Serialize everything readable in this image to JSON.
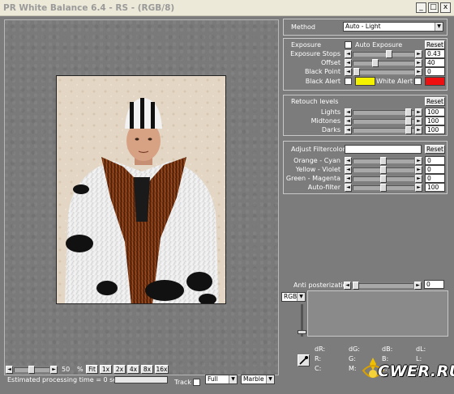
{
  "window": {
    "title": "PR White Balance 6.4 - RS - (RGB/8)",
    "min_glyph": "_",
    "max_glyph": "□",
    "close_glyph": "x"
  },
  "method": {
    "label": "Method",
    "value": "Auto - Light"
  },
  "exposure": {
    "title": "Exposure",
    "auto_label": "Auto Exposure",
    "reset": "Reset",
    "stops": {
      "label": "Exposure Stops",
      "value": "0.43",
      "level": 0.6
    },
    "offset": {
      "label": "Offset",
      "value": "40",
      "level": 0.35
    },
    "black_point": {
      "label": "Black Point",
      "value": "0",
      "level": 0.02
    },
    "black_alert": {
      "label": "Black Alert",
      "color": "#f5f200"
    },
    "white_alert": {
      "label": "White Alert",
      "color": "#ee1010"
    }
  },
  "retouch": {
    "title": "Retouch levels",
    "reset": "Reset",
    "lights": {
      "label": "Lights",
      "value": "100",
      "level": 0.95
    },
    "midtones": {
      "label": "Midtones",
      "value": "100",
      "level": 0.95
    },
    "darks": {
      "label": "Darks",
      "value": "100",
      "level": 0.95
    }
  },
  "filter": {
    "title": "Adjust Filtercolor",
    "reset": "Reset",
    "orange_cyan": {
      "label": "Orange - Cyan",
      "value": "0",
      "level": 0.5
    },
    "yellow_violet": {
      "label": "Yellow - Violet",
      "value": "0",
      "level": 0.5
    },
    "green_magenta": {
      "label": "Green - Magenta",
      "value": "0",
      "level": 0.5
    },
    "auto_filter": {
      "label": "Auto-filter",
      "value": "100",
      "level": 0.5
    }
  },
  "anti_post": {
    "label": "Anti posterization",
    "value": "0",
    "level": 0.02
  },
  "histogram": {
    "channel": "RGB",
    "dR": "dR:",
    "dG": "dG:",
    "dB": "dB:",
    "dL": "dL:",
    "R": "R:",
    "G": "G:",
    "B": "B:",
    "L": "L:",
    "C": "C:",
    "M": "M:",
    "Y": "Y:",
    "K": "K:"
  },
  "zoom": {
    "value": "50",
    "unit": "%",
    "buttons": [
      "Fit",
      "1x",
      "2x",
      "4x",
      "8x",
      "16x"
    ],
    "level": 0.5
  },
  "status": {
    "estimate": "Estimated processing time = 0 sec.",
    "track": "Track",
    "mode": "Full",
    "background": "Marble"
  },
  "watermark": "CWER.RU"
}
